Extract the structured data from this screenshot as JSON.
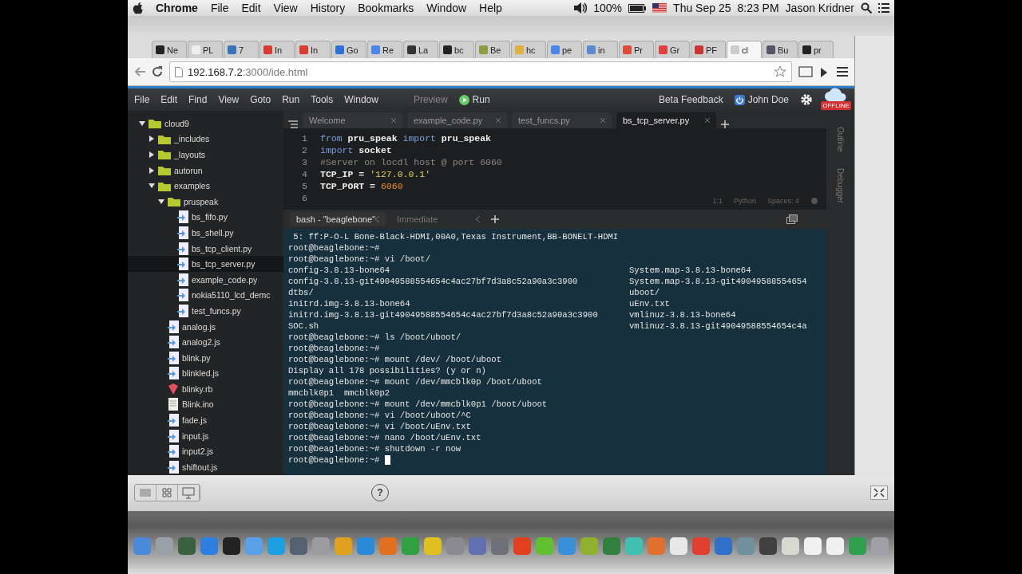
{
  "mac_menu_bar": {
    "app": "Chrome",
    "items": [
      "File",
      "Edit",
      "View",
      "History",
      "Bookmarks",
      "Window",
      "Help"
    ],
    "battery": "100%",
    "date": "Thu Sep 25",
    "time": "8:23 PM",
    "user": "Jason Kridner"
  },
  "browser": {
    "tabs": [
      {
        "label": "Ne",
        "color": "#222222",
        "selected": false
      },
      {
        "label": "PL",
        "color": "#eeeeee",
        "selected": false
      },
      {
        "label": "7",
        "color": "#3a74b5",
        "selected": false
      },
      {
        "label": "In",
        "color": "#d93b30",
        "selected": false
      },
      {
        "label": "In",
        "color": "#d93b30",
        "selected": false
      },
      {
        "label": "Go",
        "color": "#2f6fd8",
        "selected": false
      },
      {
        "label": "Re",
        "color": "#4a86e8",
        "selected": false
      },
      {
        "label": "La",
        "color": "#333333",
        "selected": false
      },
      {
        "label": "bc",
        "color": "#222222",
        "selected": false
      },
      {
        "label": "Be",
        "color": "#8aa040",
        "selected": false
      },
      {
        "label": "hc",
        "color": "#e0b040",
        "selected": false
      },
      {
        "label": "pe",
        "color": "#4a86e8",
        "selected": false
      },
      {
        "label": "in",
        "color": "#5a8ad0",
        "selected": false
      },
      {
        "label": "Pr",
        "color": "#dd4b39",
        "selected": false
      },
      {
        "label": "Gr",
        "color": "#e04040",
        "selected": false
      },
      {
        "label": "PF",
        "color": "#cc3333",
        "selected": false
      },
      {
        "label": "cl",
        "color": "#cccccc",
        "selected": true
      },
      {
        "label": "Bu",
        "color": "#555566",
        "selected": false
      },
      {
        "label": "pr",
        "color": "#222222",
        "selected": false
      }
    ],
    "url_host": "192.168.7.2",
    "url_path": ":3000/ide.html"
  },
  "ide": {
    "menus": [
      "File",
      "Edit",
      "Find",
      "View",
      "Goto",
      "Run",
      "Tools",
      "Window"
    ],
    "preview": "Preview",
    "run": "Run",
    "feedback": "Beta Feedback",
    "user": "John Doe",
    "offline_badge": "OFFLINE",
    "tree": [
      {
        "name": "cloud9",
        "kind": "folder",
        "expanded": true,
        "selected": false,
        "children": [
          {
            "name": "_includes",
            "kind": "folder",
            "expanded": false,
            "selected": false
          },
          {
            "name": "_layouts",
            "kind": "folder",
            "expanded": false,
            "selected": false
          },
          {
            "name": "autorun",
            "kind": "folder",
            "expanded": false,
            "selected": false
          },
          {
            "name": "examples",
            "kind": "folder",
            "expanded": true,
            "selected": false,
            "children": [
              {
                "name": "pruspeak",
                "kind": "folder",
                "expanded": true,
                "selected": false,
                "children": [
                  {
                    "name": "bs_fifo.py",
                    "kind": "script",
                    "selected": false
                  },
                  {
                    "name": "bs_shell.py",
                    "kind": "script",
                    "selected": false
                  },
                  {
                    "name": "bs_tcp_client.py",
                    "kind": "script",
                    "selected": false
                  },
                  {
                    "name": "bs_tcp_server.py",
                    "kind": "script",
                    "selected": true
                  },
                  {
                    "name": "example_code.py",
                    "kind": "script",
                    "selected": false
                  },
                  {
                    "name": "nokia5110_lcd_demc",
                    "kind": "script",
                    "selected": false
                  },
                  {
                    "name": "test_funcs.py",
                    "kind": "script",
                    "selected": false
                  }
                ]
              },
              {
                "name": "analog.js",
                "kind": "script",
                "selected": false
              },
              {
                "name": "analog2.js",
                "kind": "script",
                "selected": false
              },
              {
                "name": "blink.py",
                "kind": "script",
                "selected": false
              },
              {
                "name": "blinkled.js",
                "kind": "script",
                "selected": false
              },
              {
                "name": "blinky.rb",
                "kind": "ruby",
                "selected": false
              },
              {
                "name": "Blink.ino",
                "kind": "text",
                "selected": false
              },
              {
                "name": "fade.js",
                "kind": "script",
                "selected": false
              },
              {
                "name": "input.js",
                "kind": "script",
                "selected": false
              },
              {
                "name": "input2.js",
                "kind": "script",
                "selected": false
              },
              {
                "name": "shiftout.js",
                "kind": "script",
                "selected": false
              }
            ]
          }
        ]
      }
    ],
    "editor_tabs": [
      {
        "label": "Welcome",
        "selected": false
      },
      {
        "label": "example_code.py",
        "selected": false
      },
      {
        "label": "test_funcs.py",
        "selected": false
      },
      {
        "label": "bs_tcp_server.py",
        "selected": true
      }
    ],
    "code": [
      {
        "number": "1",
        "tokens": [
          {
            "text": "from",
            "kind": "keyword"
          },
          {
            "text": " pru_speak ",
            "kind": "name"
          },
          {
            "text": "import",
            "kind": "keyword"
          },
          {
            "text": " pru_speak",
            "kind": "name"
          }
        ]
      },
      {
        "number": "2",
        "tokens": [
          {
            "text": "import",
            "kind": "keyword"
          },
          {
            "text": " socket",
            "kind": "name"
          }
        ]
      },
      {
        "number": "3",
        "tokens": [
          {
            "text": "#Server on locdl host @ port 6060",
            "kind": "comment"
          }
        ]
      },
      {
        "number": "4",
        "tokens": [
          {
            "text": "TCP_IP = ",
            "kind": "name"
          },
          {
            "text": "'127.0.0.1'",
            "kind": "string"
          }
        ]
      },
      {
        "number": "5",
        "tokens": [
          {
            "text": "TCP_PORT = ",
            "kind": "name"
          },
          {
            "text": "6060",
            "kind": "number"
          }
        ]
      },
      {
        "number": "6"
      }
    ],
    "editor_status": [
      "1:1",
      "Python",
      "Spaces: 4"
    ],
    "side_panels": [
      "Outline",
      "Debugger"
    ],
    "terminal_tabs": [
      {
        "label": "bash - \"beaglebone\"",
        "selected": true
      },
      {
        "label": "Immediate",
        "selected": false
      }
    ],
    "terminal": [
      {
        "text": " 5: ff:P-O-L Bone-Black-HDMI,00A0,Texas Instrument,BB-BONELT-HDMI"
      },
      {
        "text": "root@beaglebone:~#"
      },
      {
        "text": "root@beaglebone:~# vi /boot/"
      },
      {
        "text": "config-3.8.13-bone64",
        "col2": "System.map-3.8.13-bone64"
      },
      {
        "text": "config-3.8.13-git49049588554654c4ac27bf7d3a8c52a90a3c3900",
        "col2": "System.map-3.8.13-git49049588554654"
      },
      {
        "text": "dtbs/",
        "col2": "uboot/"
      },
      {
        "text": "initrd.img-3.8.13-bone64",
        "col2": "uEnv.txt"
      },
      {
        "text": "initrd.img-3.8.13-git49049588554654c4ac27bf7d3a8c52a90a3c3900",
        "col2": "vmlinuz-3.8.13-bone64"
      },
      {
        "text": "SOC.sh",
        "col2": "vmlinuz-3.8.13-git49049588554654c4a"
      },
      {
        "text": "root@beaglebone:~# ls /boot/uboot/"
      },
      {
        "text": "root@beaglebone:~#"
      },
      {
        "text": "root@beaglebone:~# mount /dev/ /boot/uboot"
      },
      {
        "text": "Display all 178 possibilities? (y or n)"
      },
      {
        "text": "root@beaglebone:~# mount /dev/mmcblk0p /boot/uboot"
      },
      {
        "text": "mmcblk0p1  mmcblk0p2"
      },
      {
        "text": "root@beaglebone:~# mount /dev/mmcblk0p1 /boot/uboot"
      },
      {
        "text": "root@beaglebone:~# vi /boot/uboot/^C"
      },
      {
        "text": "root@beaglebone:~# vi /boot/uEnv.txt"
      },
      {
        "text": "root@beaglebone:~# nano /boot/uEnv.txt"
      },
      {
        "text": "root@beaglebone:~# shutdown -r now"
      },
      {
        "text": "root@beaglebone:~# ",
        "cursor": true
      }
    ]
  },
  "bottom_panel": {
    "help": "?"
  },
  "dock": [
    {
      "color": "#4a8ad8"
    },
    {
      "color": "#9aa0a8"
    },
    {
      "color": "#3a6040"
    },
    {
      "color": "#2f7fe0"
    },
    {
      "color": "#222222"
    },
    {
      "color": "#5aa0e8"
    },
    {
      "color": "#1ea0e0"
    },
    {
      "color": "#556070"
    },
    {
      "color": "#9a9aa0"
    },
    {
      "color": "#e0a020"
    },
    {
      "color": "#2a8ad8"
    },
    {
      "color": "#e07020"
    },
    {
      "color": "#30a040"
    },
    {
      "color": "#e0c020"
    },
    {
      "color": "#8a8a90"
    },
    {
      "color": "#6070b0"
    },
    {
      "color": "#707078"
    },
    {
      "color": "#e04020"
    },
    {
      "color": "#60c030"
    },
    {
      "color": "#3a90d8"
    },
    {
      "color": "#90b030"
    },
    {
      "color": "#308040"
    },
    {
      "color": "#40c0b0"
    },
    {
      "color": "#e07030"
    },
    {
      "color": "#e8e8e8"
    },
    {
      "color": "#e04030"
    },
    {
      "color": "#3070c8"
    },
    {
      "color": "#7090a0"
    },
    {
      "color": "#404040"
    },
    {
      "color": "#d8d8d0"
    },
    {
      "color": "#f0f0f0"
    },
    {
      "color": "#f0f0f0"
    },
    {
      "color": "#30a050"
    },
    {
      "color": "#a0a0a8"
    }
  ]
}
